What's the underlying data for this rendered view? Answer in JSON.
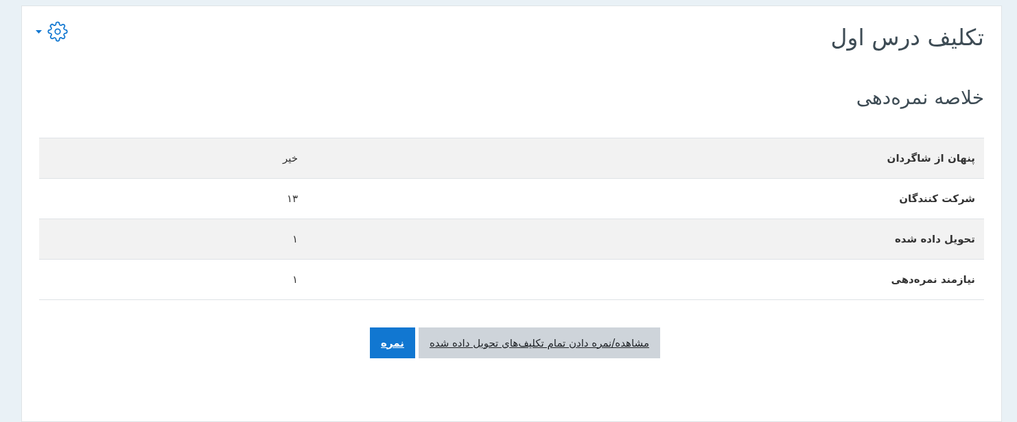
{
  "heading": "تکلیف درس اول",
  "section_title": "خلاصه نمره‌دهی",
  "summary_rows": [
    {
      "label": "پنهان از شاگردان",
      "value": "خیر"
    },
    {
      "label": "شرکت کنندگان",
      "value": "۱۳"
    },
    {
      "label": "تحویل داده شده",
      "value": "۱"
    },
    {
      "label": "نیازمند نمره‌دهی",
      "value": "۱"
    }
  ],
  "buttons": [
    {
      "label": "مشاهده/نمره دادن تمام تکلیف‌های تحویل داده شده",
      "kind": "secondary"
    },
    {
      "label": "نمره",
      "kind": "primary"
    }
  ]
}
